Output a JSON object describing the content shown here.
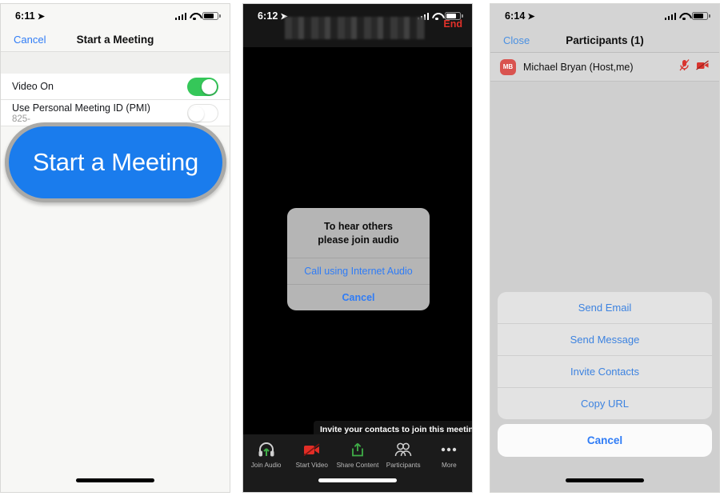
{
  "panels": {
    "start_meeting": {
      "status_bar": {
        "time": "6:11",
        "location_icon": "location-arrow-icon",
        "signal_icon": "cellular-signal-icon",
        "wifi_icon": "wifi-icon",
        "battery_icon": "battery-icon"
      },
      "nav": {
        "left_label": "Cancel",
        "title": "Start a Meeting"
      },
      "rows": [
        {
          "label": "Video On",
          "sub": "",
          "toggle": "on"
        },
        {
          "label": "Use Personal Meeting ID (PMI)",
          "sub": "825-",
          "toggle": "off"
        }
      ],
      "callout_button": "Start a Meeting"
    },
    "in_meeting": {
      "status_bar": {
        "time": "6:12",
        "location_icon": "location-arrow-icon",
        "signal_icon": "cellular-signal-icon",
        "wifi_icon": "wifi-icon",
        "battery_icon": "battery-icon"
      },
      "end_label": "End",
      "redacted_title": "",
      "alert": {
        "message_line1": "To hear others",
        "message_line2": "please join audio",
        "primary_action": "Call using Internet Audio",
        "cancel_action": "Cancel"
      },
      "tooltip": "Invite your contacts to join this meeting",
      "toolbar": [
        {
          "label": "Join Audio",
          "icon": "headset-icon"
        },
        {
          "label": "Start Video",
          "icon": "video-off-icon"
        },
        {
          "label": "Share Content",
          "icon": "share-upload-icon"
        },
        {
          "label": "Participants",
          "icon": "participants-icon"
        },
        {
          "label": "More",
          "icon": "more-dots-icon"
        }
      ]
    },
    "participants": {
      "status_bar": {
        "time": "6:14",
        "location_icon": "location-arrow-icon",
        "signal_icon": "cellular-signal-icon",
        "wifi_icon": "wifi-icon",
        "battery_icon": "battery-icon"
      },
      "nav": {
        "left_label": "Close",
        "title": "Participants (1)"
      },
      "list": [
        {
          "initials": "MB",
          "name": "Michael Bryan (Host,me)",
          "mic_icon": "microphone-muted-icon",
          "video_icon": "video-off-icon"
        }
      ],
      "action_sheet": {
        "items": [
          "Send Email",
          "Send Message",
          "Invite Contacts",
          "Copy URL"
        ],
        "cancel": "Cancel"
      }
    }
  },
  "colors": {
    "ios_blue": "#2f7cf6",
    "toggle_green": "#35c759",
    "end_red": "#e0312a",
    "avatar_red": "#d9534f",
    "callout_blue": "#1a7ced",
    "video_off_red": "#e12d26",
    "share_green": "#3fae47"
  }
}
